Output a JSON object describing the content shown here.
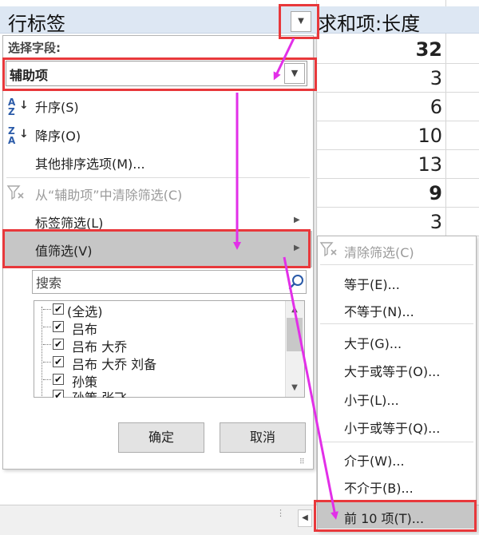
{
  "sheet": {
    "row_label_header": "行标签",
    "sum_header": "求和项:长度",
    "values": [
      {
        "text": "32",
        "bold": true
      },
      {
        "text": "3",
        "bold": false
      },
      {
        "text": "6",
        "bold": false
      },
      {
        "text": "10",
        "bold": false
      },
      {
        "text": "13",
        "bold": false
      },
      {
        "text": "9",
        "bold": true
      },
      {
        "text": "3",
        "bold": false
      }
    ]
  },
  "panel": {
    "field_label": "选择字段:",
    "field_value": "辅助项",
    "menu": {
      "sort_asc": "升序(S)",
      "sort_desc": "降序(O)",
      "more_sort": "其他排序选项(M)...",
      "clear_filter": "从“辅助项”中清除筛选(C)",
      "label_filter": "标签筛选(L)",
      "value_filter": "值筛选(V)"
    },
    "search_placeholder": "搜索",
    "list_items": [
      "(全选)",
      "吕布",
      "吕布 大乔",
      "吕布 大乔 刘备",
      "孙策",
      "孙策 张飞"
    ],
    "ok_label": "确定",
    "cancel_label": "取消"
  },
  "submenu": {
    "items": [
      {
        "label": "清除筛选(C)",
        "disabled": true
      },
      {
        "label": "等于(E)...",
        "disabled": false
      },
      {
        "label": "不等于(N)...",
        "disabled": false
      },
      {
        "label": "大于(G)...",
        "disabled": false
      },
      {
        "label": "大于或等于(O)...",
        "disabled": false
      },
      {
        "label": "小于(L)...",
        "disabled": false
      },
      {
        "label": "小于或等于(Q)...",
        "disabled": false
      },
      {
        "label": "介于(W)...",
        "disabled": false
      },
      {
        "label": "不介于(B)...",
        "disabled": false
      },
      {
        "label": "前 10 项(T)...",
        "disabled": false
      }
    ]
  },
  "colors": {
    "annotation_red": "#e8383b",
    "annotation_arrow": "#e22fe8",
    "header_bg": "#dde7f3",
    "highlight_gray": "#c6c6c6"
  }
}
